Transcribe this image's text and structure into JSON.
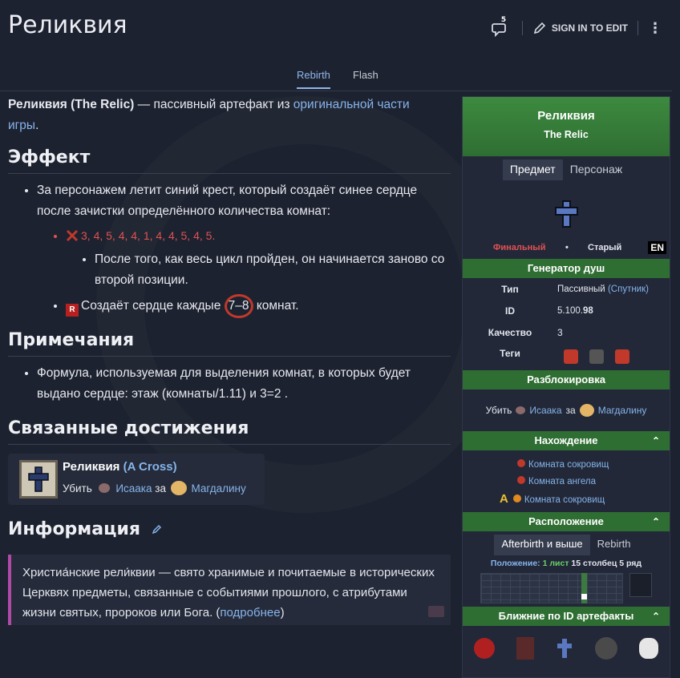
{
  "page": {
    "title": "Реликвия"
  },
  "header": {
    "talk_count": "5",
    "sign_in": "SIGN IN TO EDIT"
  },
  "tabs": [
    "Rebirth",
    "Flash"
  ],
  "intro": {
    "bold": "Реликвия (The Relic)",
    "text": " — пассивный артефакт из ",
    "link": "оригинальной части игры",
    "end": "."
  },
  "effect": {
    "heading": "Эффект",
    "item1": "За персонажем летит синий крест, который создаёт синее сердце после зачистки определённого количества комнат:",
    "sequence": "3, 4, 5, 4, 4, 1, 4, 4, 5, 4, 5.",
    "sub_note": "После того, как весь цикл пройден, он начинается заново со второй позиции.",
    "item2_before": "Создаёт сердце каждые ",
    "item2_range": "7–8",
    "item2_after": " комнат."
  },
  "notes": {
    "heading": "Примечания",
    "item": "Формула, используемая для выделения комнат, в которых будет выдано сердце: этаж (комнаты/1.11) и 3=2 ."
  },
  "achievements": {
    "heading": "Связанные достижения",
    "name": "Реликвия",
    "name_link": "(A Cross)",
    "kill": "Убить",
    "isaac": "Исаака",
    "as": "за",
    "magdalene": "Магдалину"
  },
  "info": {
    "heading": "Информация",
    "quote_part1": "Христиа́нские рели́квии — свято хранимые и почитаемые в исторических Церквях предметы, связанные с событиями прошлого, с атрибутами жизни святых, пророков или Бога. (",
    "quote_link": "подробнее",
    "quote_end": ")"
  },
  "infobox": {
    "name": "Реликвия",
    "name_en": "The Relic",
    "tabs": [
      "Предмет",
      "Персонаж"
    ],
    "final_label": "Финальный",
    "dot": "•",
    "old_label": "Старый",
    "generator": "Генератор душ",
    "type_label": "Тип",
    "type_value": "Пассивный",
    "type_extra": "(Спутник)",
    "id_label": "ID",
    "id_prefix": "5.100.",
    "id_num": "98",
    "quality_label": "Качество",
    "quality_value": "3",
    "tags_label": "Теги",
    "unlock": "Разблокировка",
    "unlock_kill": "Убить",
    "unlock_isaac": "Исаака",
    "unlock_as": "за",
    "unlock_mag": "Магдалину",
    "found": "Нахождение",
    "pool1": "Комната сокровищ",
    "pool2": "Комната ангела",
    "pool3": "Комната сокровищ",
    "pool3_prefix": "A",
    "location": "Расположение",
    "loc_tabs": [
      "Afterbirth и выше",
      "Rebirth"
    ],
    "position_label": "Положение:",
    "pos_sheet": "1",
    "pos_sheet_word": "лист",
    "pos_col": "15",
    "pos_col_word": "столбец",
    "pos_row": "5",
    "pos_row_word": "ряд",
    "nearby": "Ближние по ID артефакты"
  },
  "colors": {
    "accent_green": "#2f6e33",
    "link": "#86b4ea",
    "red": "#e05252",
    "quote_border": "#b04aa8"
  }
}
